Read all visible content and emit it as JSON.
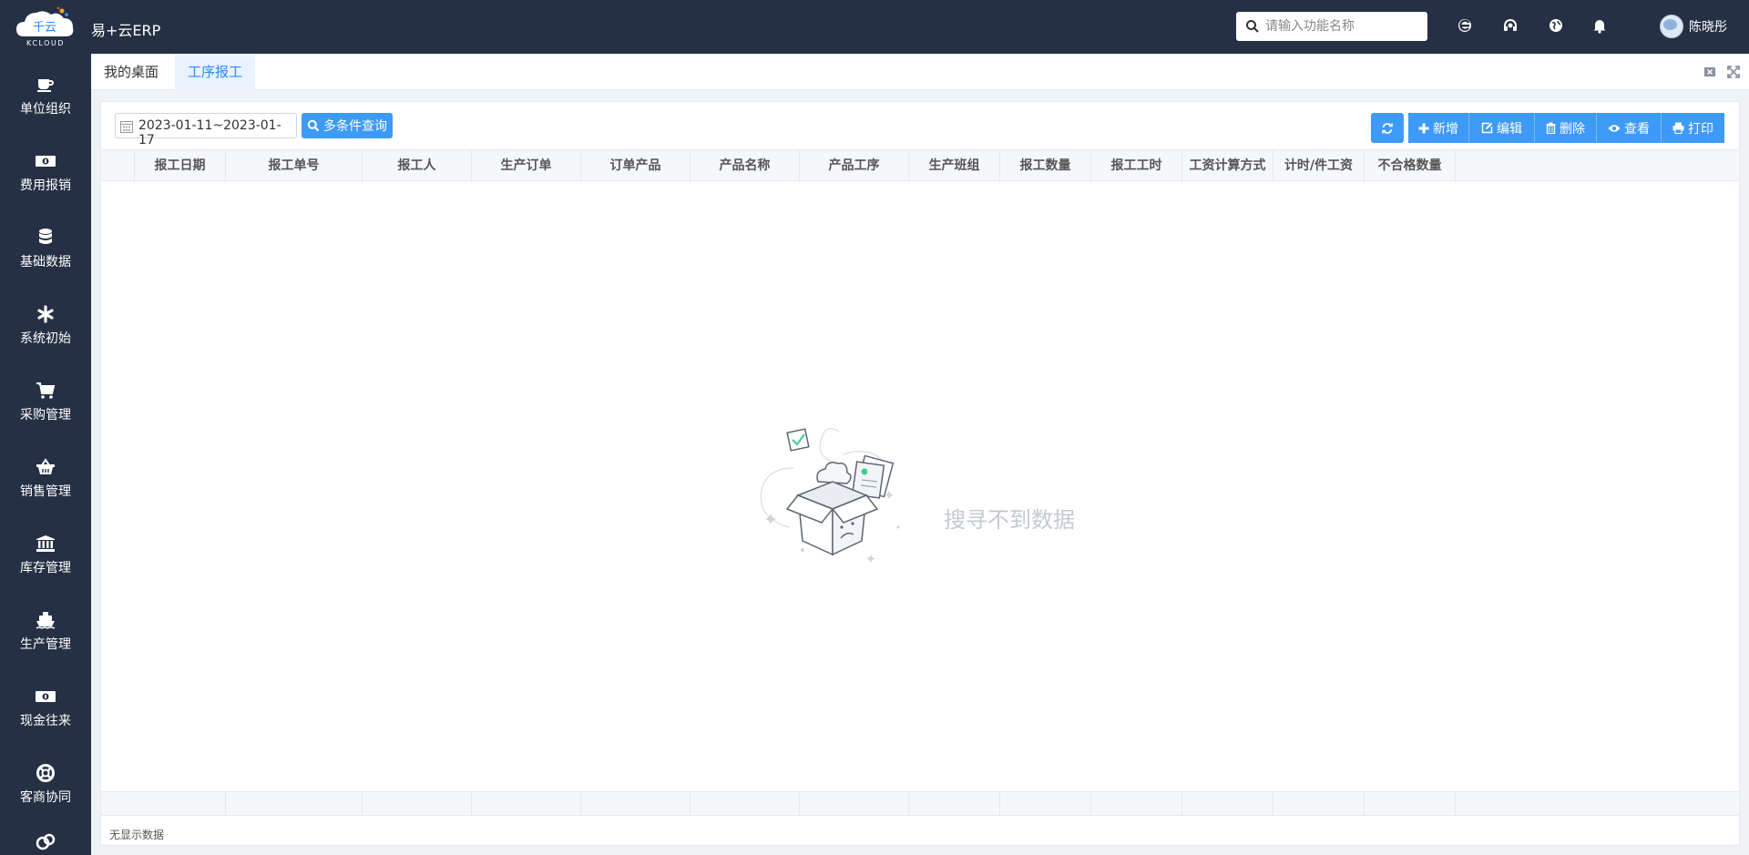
{
  "app": {
    "logo_text": "千云",
    "logo_sub": "KCLOUD",
    "title": "易+云ERP"
  },
  "search": {
    "placeholder": "请输入功能名称",
    "value": ""
  },
  "top_icons": [
    "ie-icon",
    "headset-icon",
    "globe-icon",
    "bell-icon"
  ],
  "user": {
    "name": "陈晓彤"
  },
  "sidebar": {
    "items": [
      {
        "label": "单位组织",
        "icon": "coffee-icon"
      },
      {
        "label": "费用报销",
        "icon": "money-icon"
      },
      {
        "label": "基础数据",
        "icon": "database-icon"
      },
      {
        "label": "系统初始",
        "icon": "asterisk-icon"
      },
      {
        "label": "采购管理",
        "icon": "cart-icon"
      },
      {
        "label": "销售管理",
        "icon": "basket-icon"
      },
      {
        "label": "库存管理",
        "icon": "bank-icon"
      },
      {
        "label": "生产管理",
        "icon": "ship-icon"
      },
      {
        "label": "现金往来",
        "icon": "money-icon"
      },
      {
        "label": "客商协同",
        "icon": "lifebuoy-icon"
      }
    ]
  },
  "tabs": [
    {
      "label": "我的桌面",
      "active": false
    },
    {
      "label": "工序报工",
      "active": true
    }
  ],
  "toolbar": {
    "date_range": "2023-01-11~2023-01-17",
    "multi_query": "多条件查询",
    "add": "新增",
    "edit": "编辑",
    "delete": "删除",
    "view": "查看",
    "print": "打印"
  },
  "table": {
    "columns": [
      "报工日期",
      "报工单号",
      "报工人",
      "生产订单",
      "订单产品",
      "产品名称",
      "产品工序",
      "生产班组",
      "报工数量",
      "报工工时",
      "工资计算方式",
      "计时/件工资",
      "不合格数量"
    ],
    "rows": [],
    "empty_text": "搜寻不到数据"
  },
  "status": {
    "text": "无显示数据"
  },
  "colors": {
    "topbar": "#253044",
    "accent": "#3d9af7",
    "tab_active": "#2c8af8"
  }
}
